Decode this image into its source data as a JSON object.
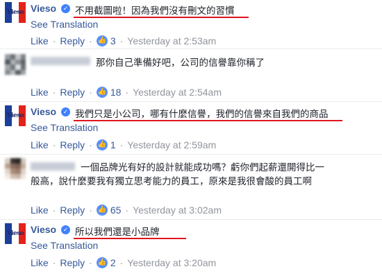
{
  "ui": {
    "see_translation": "See Translation",
    "like": "Like",
    "reply": "Reply",
    "dot": "·"
  },
  "colors": {
    "link": "#365899",
    "meta": "#90949c",
    "underline": "#e0141e",
    "like_bubble": "#5890ff",
    "verified_badge": "#4080ff"
  },
  "comments": [
    {
      "author": "Vieso",
      "verified": true,
      "avatar": "vieso-logo",
      "text": "不用截圖啦！因為我們沒有刪文的習慣",
      "reactions": "3",
      "time": "Yesterday at 2:53am"
    },
    {
      "author_redacted": true,
      "avatar": "blurred-avatar",
      "text": "那你自己準備好吧，公司的信譽靠你稱了",
      "reactions": "18",
      "time": "Yesterday at 2:54am"
    },
    {
      "author": "Vieso",
      "verified": true,
      "avatar": "vieso-logo",
      "text": "我們只是小公司，哪有什麼信譽，我們的信譽來自我們的商品",
      "reactions": "1",
      "time": "Yesterday at 2:59am"
    },
    {
      "author_redacted": true,
      "avatar": "blurred-avatar",
      "text_line1": "一個品牌光有好的設計就能成功嗎？虧你們起薪還開得比一",
      "text_line2": "般高，說什麼要我有獨立思考能力的員工，原來是我很會酸的員工啊",
      "reactions": "65",
      "time": "Yesterday at 3:02am"
    },
    {
      "author": "Vieso",
      "verified": true,
      "avatar": "vieso-logo",
      "text": "所以我們還是小品牌",
      "reactions": "2",
      "time": "Yesterday at 3:20am"
    }
  ]
}
